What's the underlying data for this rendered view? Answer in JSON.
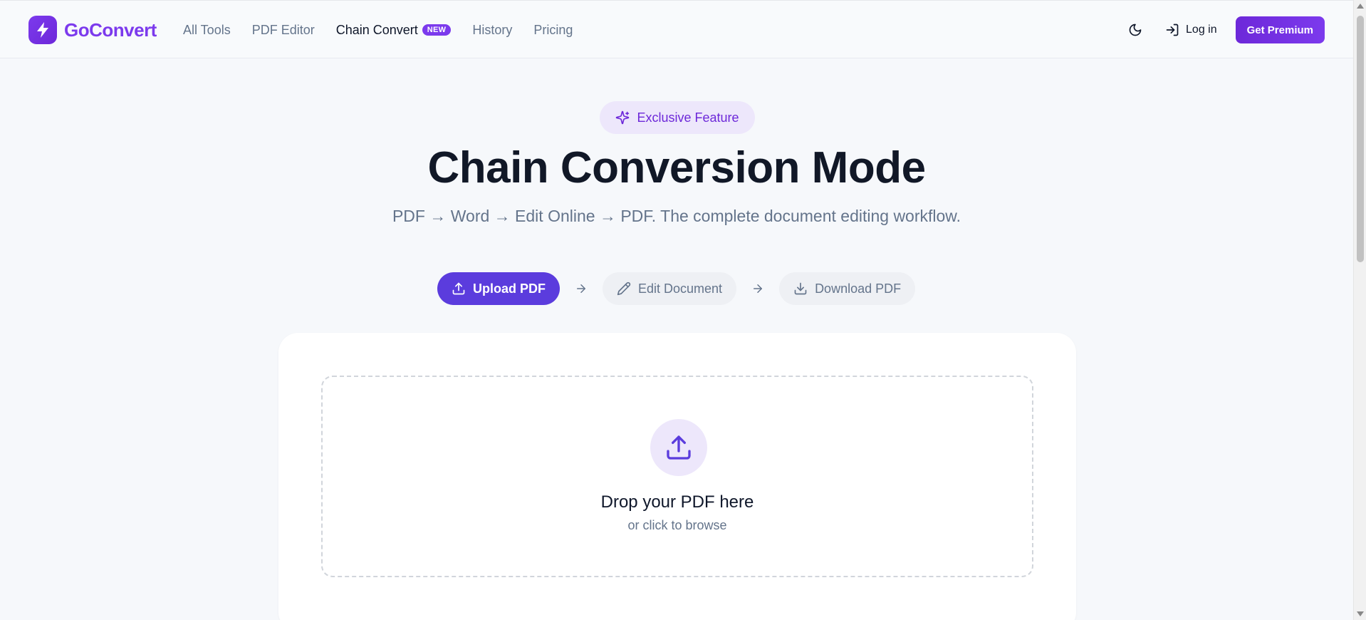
{
  "brand": {
    "name": "GoConvert"
  },
  "nav": {
    "items": [
      {
        "label": "All Tools"
      },
      {
        "label": "PDF Editor"
      },
      {
        "label": "Chain Convert",
        "badge": "NEW"
      },
      {
        "label": "History"
      },
      {
        "label": "Pricing"
      }
    ]
  },
  "header": {
    "login_label": "Log in",
    "premium_label": "Get Premium"
  },
  "hero": {
    "pill_label": "Exclusive Feature",
    "title": "Chain Conversion Mode",
    "subtitle": "PDF → Word → Edit Online → PDF. The complete document editing workflow."
  },
  "steps": [
    {
      "label": "Upload PDF",
      "icon": "upload-icon",
      "state": "active"
    },
    {
      "label": "Edit Document",
      "icon": "pencil-icon",
      "state": "idle"
    },
    {
      "label": "Download PDF",
      "icon": "download-icon",
      "state": "idle"
    }
  ],
  "upload": {
    "title": "Drop your PDF here",
    "subtitle": "or click to browse"
  },
  "colors": {
    "brand": "#7c3aed",
    "accent": "#5b3cdd",
    "text": "#0f172a",
    "muted": "#64748b"
  }
}
